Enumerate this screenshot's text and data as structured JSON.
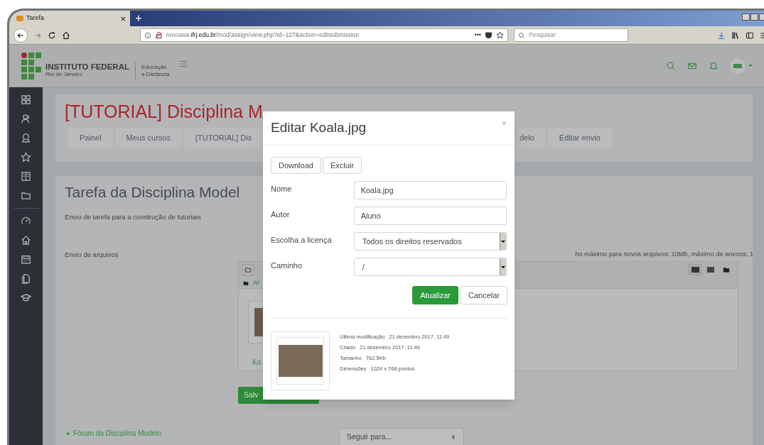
{
  "browser": {
    "tab": {
      "title": "Tarefa",
      "close": "×"
    },
    "new_tab": "+",
    "url": {
      "prefix": "novoava.",
      "host": "ifrj.edu.br",
      "path": "/mod/assign/view.php?id=127&action=editsubmission"
    },
    "page_actions": "•••",
    "search": {
      "placeholder": "Pesquisar"
    }
  },
  "header": {
    "org_name": "INSTITUTO FEDERAL",
    "org_sub": "Rio de Janeiro",
    "unit_line1": "Educação",
    "unit_line2": "a Distância"
  },
  "course": {
    "title": "[TUTORIAL] Disciplina M",
    "breadcrumb": [
      "Painel",
      "Meus cursos",
      "[TUTORIAL] Dis",
      "delo",
      "Editar envio"
    ]
  },
  "assignment": {
    "title": "Tarefa da Disciplina Model",
    "description": "Envio de tarefa para a construção de tutoriais",
    "files_label": "Envio de arquivos",
    "limits": "ho máximo para novos arquivos: 10Mb, máximo de anexos: 1",
    "folder_link": "Ar",
    "file_name": "Ko",
    "save_button": "Salv",
    "prev_link": "Fórum da Disciplina Modelo",
    "jump_select": "Seguir para..."
  },
  "modal": {
    "title": "Editar Koala.jpg",
    "close": "×",
    "actions": [
      "Download",
      "Excluir"
    ],
    "fields": [
      {
        "kind": "text",
        "label": "Nome",
        "value": "Koala.jpg"
      },
      {
        "kind": "text",
        "label": "Autor",
        "value": "Aluno"
      },
      {
        "kind": "select",
        "label": "Escolha a licença",
        "value": "Todos os direitos reservados"
      },
      {
        "kind": "select",
        "label": "Caminho",
        "value": "/"
      }
    ],
    "buttons": [
      {
        "kind": "primary",
        "label": "Atualizar"
      },
      {
        "kind": "default",
        "label": "Cancelar"
      }
    ],
    "info": [
      {
        "label": "Última modificação",
        "value": "21 dezembro 2017, 11:49"
      },
      {
        "label": "Criado",
        "value": "21 dezembro 2017, 11:49"
      },
      {
        "label": "Tamanho",
        "value": "762.5Kb"
      },
      {
        "label": "Dimensões",
        "value": "1024 x 768 pontos"
      }
    ]
  }
}
